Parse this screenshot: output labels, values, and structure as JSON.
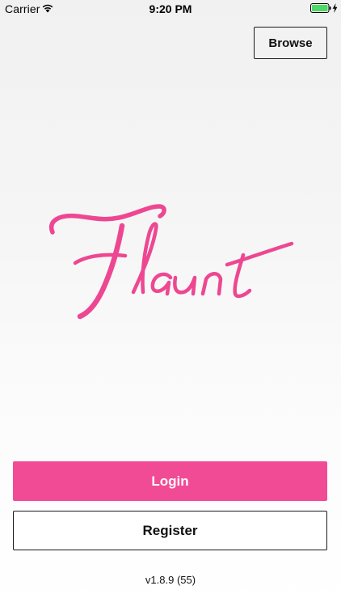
{
  "status_bar": {
    "carrier": "Carrier",
    "time": "9:20 PM",
    "wifi_icon": "wifi-icon",
    "battery_icon": "battery-full-icon",
    "charge_icon": "charging-bolt-icon",
    "battery_color": "#4cd964"
  },
  "header": {
    "browse_label": "Browse"
  },
  "logo": {
    "text": "Flaunt",
    "color": "#ee4792"
  },
  "actions": {
    "login_label": "Login",
    "register_label": "Register",
    "accent_color": "#f24b95"
  },
  "footer": {
    "version": "v1.8.9 (55)"
  }
}
